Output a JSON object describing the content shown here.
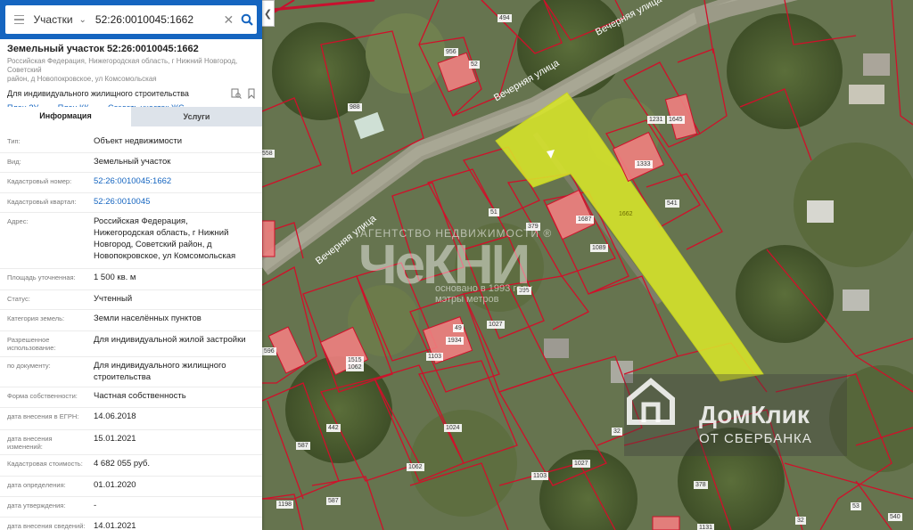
{
  "search": {
    "layer": "Участки",
    "query": "52:26:0010045:1662"
  },
  "parcel": {
    "title": "Земельный участок 52:26:0010045:1662",
    "address_lines": [
      "Российская Федерация, Нижегородская область, г Нижний Новгород, Советский",
      "район, д Новопокровское, ул Комсомольская"
    ],
    "permitted_use": "Для индивидуального жилищного строительства",
    "links": [
      {
        "label": "План ЗУ"
      },
      {
        "label": "План КК"
      },
      {
        "label": "Создать участок ЖС"
      }
    ]
  },
  "tabs": [
    {
      "label": "Информация",
      "active": true
    },
    {
      "label": "Услуги",
      "active": false
    }
  ],
  "properties": [
    {
      "key": "Тип:",
      "lines": [
        "Объект недвижимости"
      ]
    },
    {
      "key": "Вид:",
      "lines": [
        "Земельный участок"
      ]
    },
    {
      "key": "Кадастровый номер:",
      "lines": [
        "52:26:0010045:1662"
      ],
      "link": true
    },
    {
      "key": "Кадастровый квартал:",
      "lines": [
        "52:26:0010045"
      ],
      "link": true
    },
    {
      "key": "Адрес:",
      "lines": [
        "Российская Федерация,",
        "Нижегородская область, г Нижний",
        "Новгород, Советский район, д",
        "Новопокровское, ул Комсомольская"
      ]
    },
    {
      "key": "Площадь уточненная:",
      "lines": [
        "1 500 кв. м"
      ]
    },
    {
      "key": "Статус:",
      "lines": [
        "Учтенный"
      ]
    },
    {
      "key": "Категория земель:",
      "lines": [
        "Земли населённых пунктов"
      ]
    },
    {
      "key": "Разрешенное использование:",
      "lines": [
        "Для индивидуальной жилой застройки"
      ]
    },
    {
      "key": "по документу:",
      "lines": [
        "Для индивидуального жилищного",
        "строительства"
      ]
    },
    {
      "key": "Форма собственности:",
      "lines": [
        "Частная собственность"
      ]
    },
    {
      "key": "дата внесения в ЕГРН:",
      "lines": [
        "14.06.2018"
      ]
    },
    {
      "key": "дата внесения изменений:",
      "lines": [
        "15.01.2021"
      ]
    },
    {
      "key": "Кадастровая стоимость:",
      "lines": [
        "4 682 055 руб."
      ]
    },
    {
      "key": "дата определения:",
      "lines": [
        "01.01.2020"
      ]
    },
    {
      "key": "дата утверждения:",
      "lines": [
        "-"
      ]
    },
    {
      "key": "дата внесения сведений:",
      "lines": [
        "14.01.2021"
      ]
    }
  ],
  "map": {
    "street_labels": [
      "Вечерняя улица",
      "Вечерняя улица",
      "Вечерняя улица"
    ],
    "parcel_labels": [
      "494",
      "956",
      "52",
      "988",
      "558",
      "1231",
      "1645",
      "1333",
      "541",
      "51",
      "379",
      "1687",
      "1089",
      "1662",
      "395",
      "1027",
      "49",
      "1934",
      "1103",
      "1515",
      "1062",
      "596",
      "1024",
      "442",
      "587",
      "1062",
      "1027",
      "1103",
      "32",
      "1198",
      "587",
      "378",
      "53",
      "540",
      "32",
      "1131"
    ],
    "highlight_color": "#d8e62a",
    "building_color": "#f08080",
    "boundary_color": "#d0102a"
  },
  "watermarks": {
    "chekni_top": "АГЕНТСТВО НЕДВИЖИМОСТИ ®",
    "chekni_big": "ЧеКНИ",
    "chekni_sub1": "основано в 1993 году",
    "chekni_sub2": "мэтры метров",
    "domclick_name": "ДомКлик",
    "domclick_sub": "ОТ СБЕРБАНКА"
  }
}
